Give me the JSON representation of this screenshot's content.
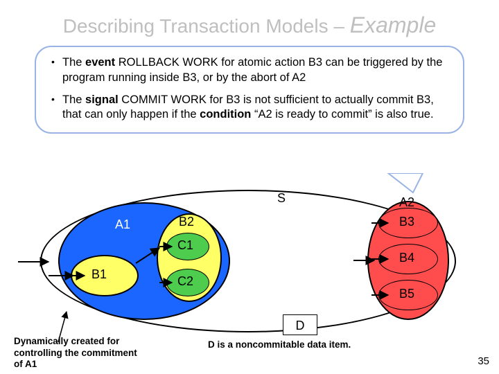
{
  "title_part1": "Describing Transaction Models – ",
  "title_part2": "Example",
  "bullets": {
    "b1_pre": "The ",
    "b1_kw": "event",
    "b1_rest": " ROLLBACK WORK for atomic action B3 can be triggered by the program running inside B3, or by the abort of A2",
    "b2_pre": "The ",
    "b2_kw1": "signal",
    "b2_mid": " COMMIT WORK for B3 is not sufficient to actually commit B3, that can only happen if the ",
    "b2_kw2": "condition",
    "b2_end": " “A2 is ready to commit” is also true."
  },
  "labels": {
    "S": "S",
    "A1": "A1",
    "A2": "A2",
    "B1": "B1",
    "B2": "B2",
    "B3": "B3",
    "B4": "B4",
    "B5": "B5",
    "C1": "C1",
    "C2": "C2",
    "D": "D"
  },
  "dnote": "D is a noncommitable data item.",
  "dyn_note": "Dynamically created for controlling the commitment of A1",
  "pagenum": "35"
}
